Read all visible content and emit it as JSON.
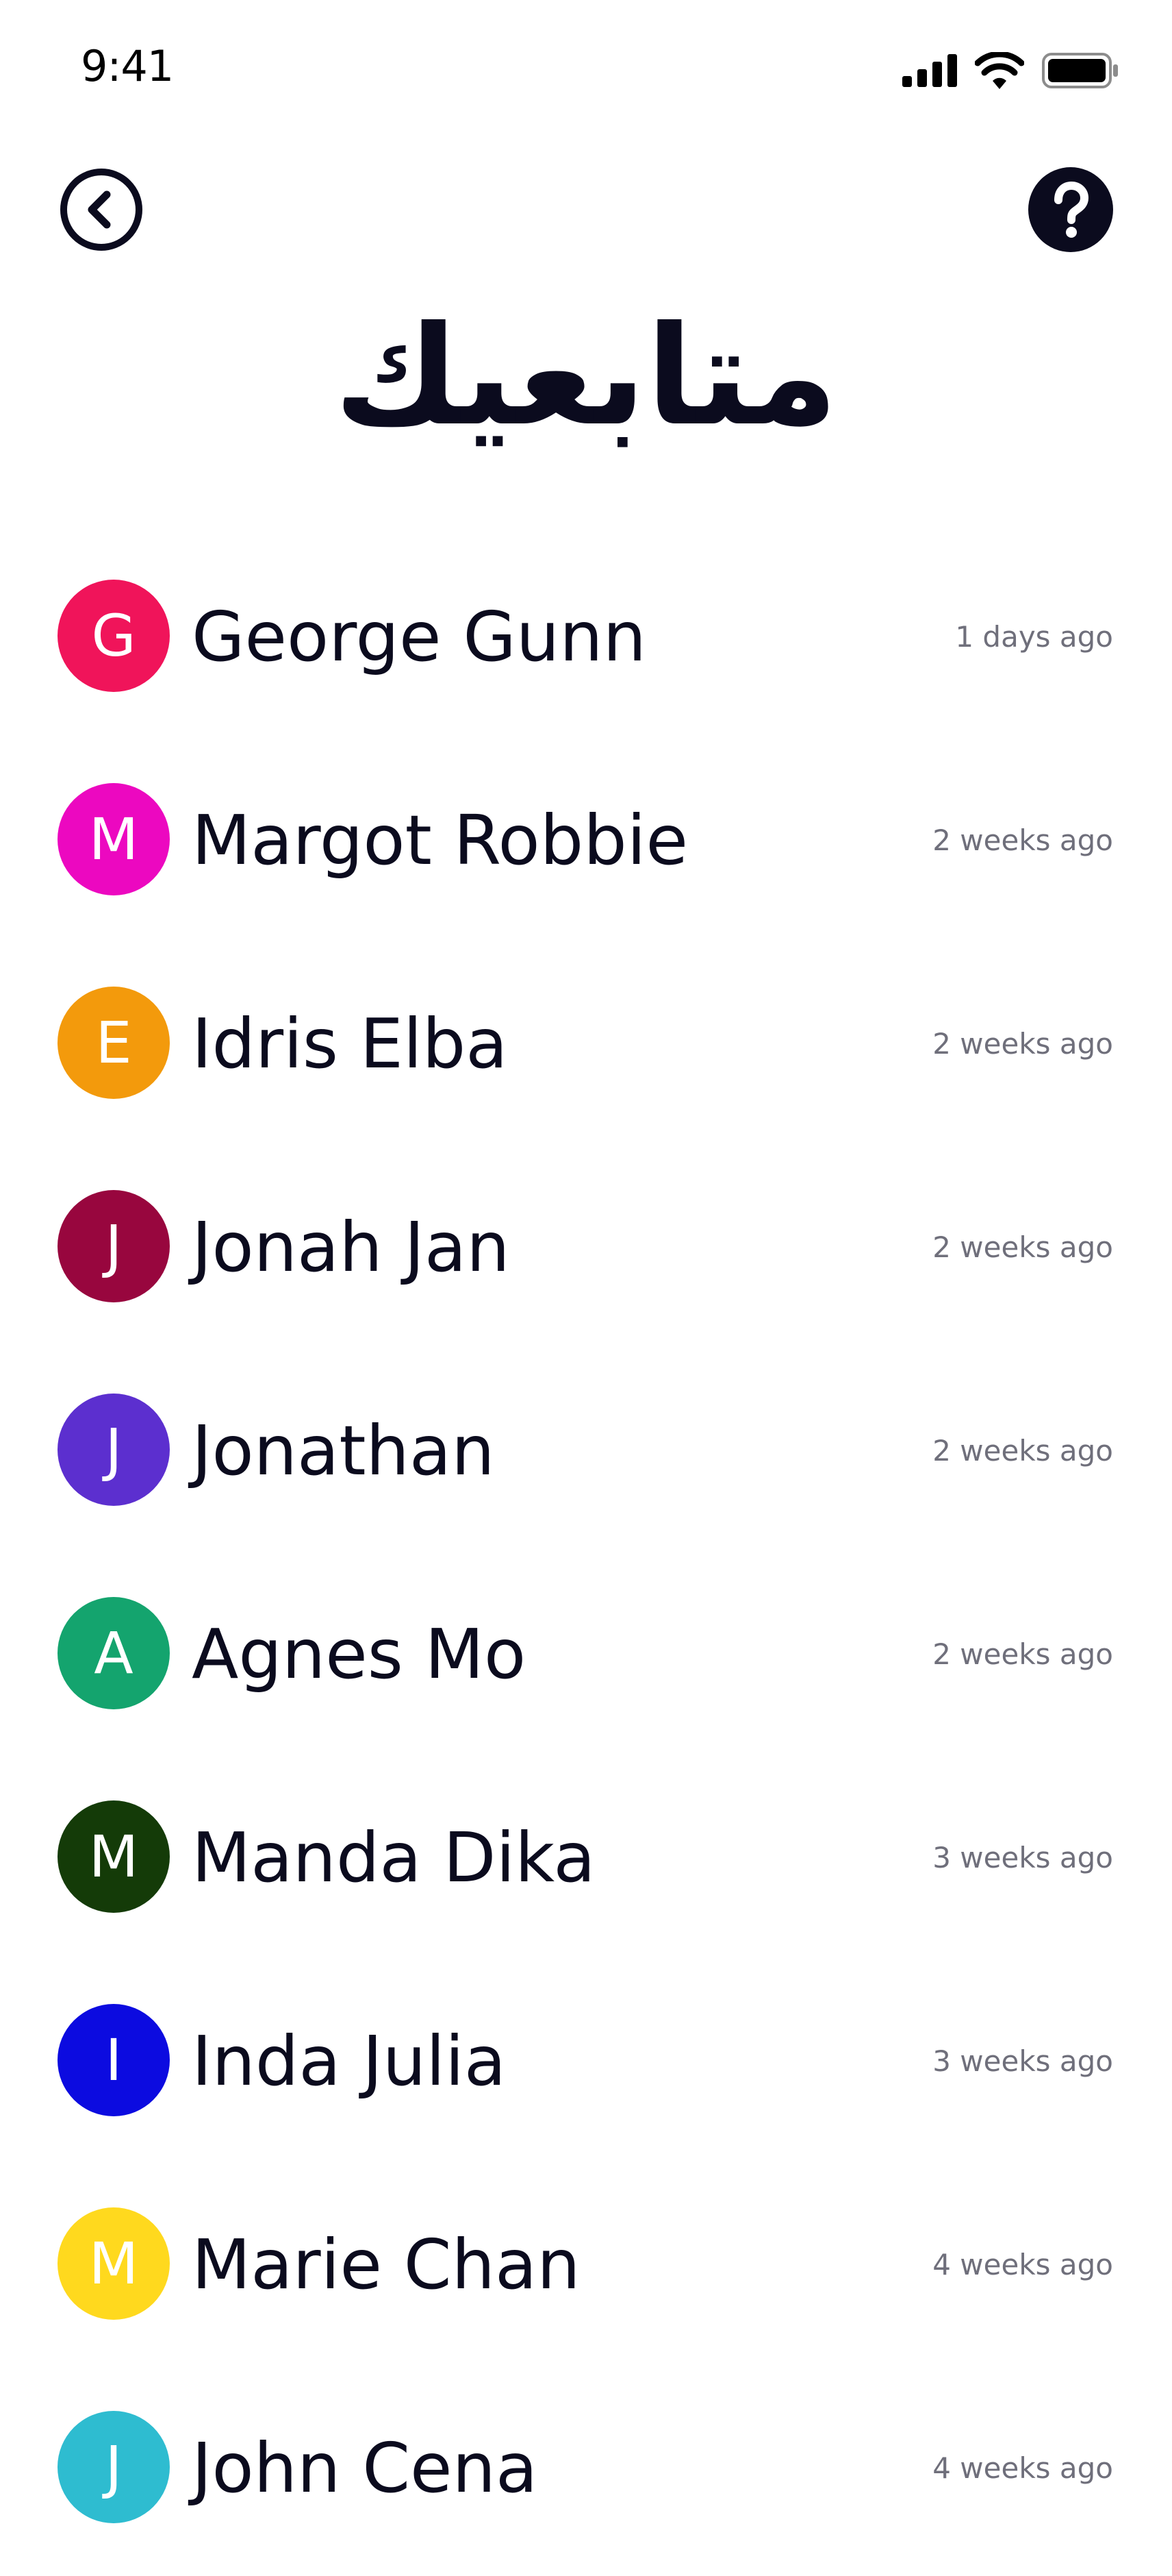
{
  "status_bar": {
    "time": "9:41"
  },
  "header": {
    "title": "متابعيك",
    "back_icon": "chevron-left-circle-icon",
    "help_icon": "question-circle-icon"
  },
  "followers": [
    {
      "initial": "G",
      "name": "George Gunn",
      "time": "1 days ago",
      "color": "#F0145A"
    },
    {
      "initial": "M",
      "name": "Margot Robbie",
      "time": "2 weeks ago",
      "color": "#EC08C0"
    },
    {
      "initial": "E",
      "name": "Idris Elba",
      "time": "2 weeks ago",
      "color": "#F39A0C"
    },
    {
      "initial": "J",
      "name": "Jonah Jan",
      "time": "2 weeks ago",
      "color": "#98063E"
    },
    {
      "initial": "J",
      "name": "Jonathan",
      "time": "2 weeks ago",
      "color": "#5C2FCF"
    },
    {
      "initial": "A",
      "name": "Agnes Mo",
      "time": "2 weeks ago",
      "color": "#14A46E"
    },
    {
      "initial": "M",
      "name": "Manda Dika",
      "time": "3 weeks ago",
      "color": "#143B08"
    },
    {
      "initial": "I",
      "name": "Inda Julia",
      "time": "3 weeks ago",
      "color": "#0C0BE0"
    },
    {
      "initial": "M",
      "name": "Marie Chan",
      "time": "4 weeks ago",
      "color": "#FFD91E"
    },
    {
      "initial": "J",
      "name": "John Cena",
      "time": "4 weeks ago",
      "color": "#2EBCD0"
    }
  ]
}
